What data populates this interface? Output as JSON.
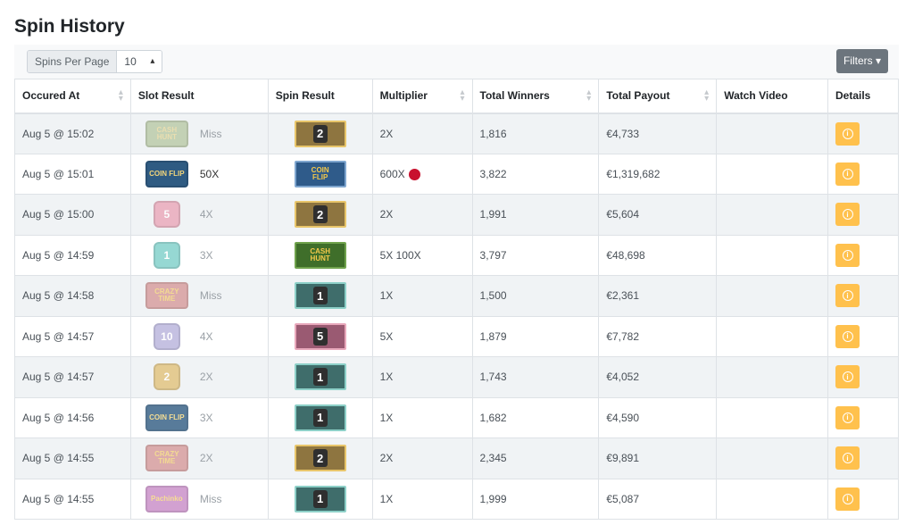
{
  "title": "Spin History",
  "toolbar": {
    "per_page_label": "Spins Per Page",
    "per_page_value": "10",
    "filters_label": "Filters"
  },
  "columns": [
    "Occured At",
    "Slot Result",
    "Spin Result",
    "Multiplier",
    "Total Winners",
    "Total Payout",
    "Watch Video",
    "Details"
  ],
  "colors": {
    "filters_button": "#6c757d",
    "details_button": "#ffc14d",
    "stripe": "#f0f3f5",
    "red_dot": "#c8102e"
  },
  "rows": [
    {
      "time": "Aug 5 @ 15:02",
      "slot_icon": "cash-hunt",
      "slot_label": "CASH HUNT",
      "slot_text": "Miss",
      "spin_icon": "2",
      "multiplier": "2X",
      "red_dot": false,
      "winners": "1,816",
      "payout": "€4,733"
    },
    {
      "time": "Aug 5 @ 15:01",
      "slot_icon": "coin-flip",
      "slot_label": "COIN FLIP",
      "slot_text": "50X",
      "spin_icon": "coin-flip",
      "multiplier": "600X",
      "red_dot": true,
      "winners": "3,822",
      "payout": "€1,319,682"
    },
    {
      "time": "Aug 5 @ 15:00",
      "slot_icon": "5",
      "slot_label": "5",
      "slot_text": "4X",
      "spin_icon": "2",
      "multiplier": "2X",
      "red_dot": false,
      "winners": "1,991",
      "payout": "€5,604"
    },
    {
      "time": "Aug 5 @ 14:59",
      "slot_icon": "1",
      "slot_label": "1",
      "slot_text": "3X",
      "spin_icon": "cash-hunt",
      "multiplier": "5X 100X",
      "red_dot": false,
      "winners": "3,797",
      "payout": "€48,698"
    },
    {
      "time": "Aug 5 @ 14:58",
      "slot_icon": "crazy-time",
      "slot_label": "CRAZY TIME",
      "slot_text": "Miss",
      "spin_icon": "1",
      "multiplier": "1X",
      "red_dot": false,
      "winners": "1,500",
      "payout": "€2,361"
    },
    {
      "time": "Aug 5 @ 14:57",
      "slot_icon": "10",
      "slot_label": "10",
      "slot_text": "4X",
      "spin_icon": "5",
      "multiplier": "5X",
      "red_dot": false,
      "winners": "1,879",
      "payout": "€7,782"
    },
    {
      "time": "Aug 5 @ 14:57",
      "slot_icon": "2",
      "slot_label": "2",
      "slot_text": "2X",
      "spin_icon": "1",
      "multiplier": "1X",
      "red_dot": false,
      "winners": "1,743",
      "payout": "€4,052"
    },
    {
      "time": "Aug 5 @ 14:56",
      "slot_icon": "coin-flip",
      "slot_label": "COIN FLIP",
      "slot_text": "3X",
      "spin_icon": "1",
      "multiplier": "1X",
      "red_dot": false,
      "winners": "1,682",
      "payout": "€4,590"
    },
    {
      "time": "Aug 5 @ 14:55",
      "slot_icon": "crazy-time",
      "slot_label": "CRAZY TIME",
      "slot_text": "2X",
      "spin_icon": "2",
      "multiplier": "2X",
      "red_dot": false,
      "winners": "2,345",
      "payout": "€9,891"
    },
    {
      "time": "Aug 5 @ 14:55",
      "slot_icon": "pachinko",
      "slot_label": "Pachinko",
      "slot_text": "Miss",
      "spin_icon": "1",
      "multiplier": "1X",
      "red_dot": false,
      "winners": "1,999",
      "payout": "€5,087"
    }
  ]
}
